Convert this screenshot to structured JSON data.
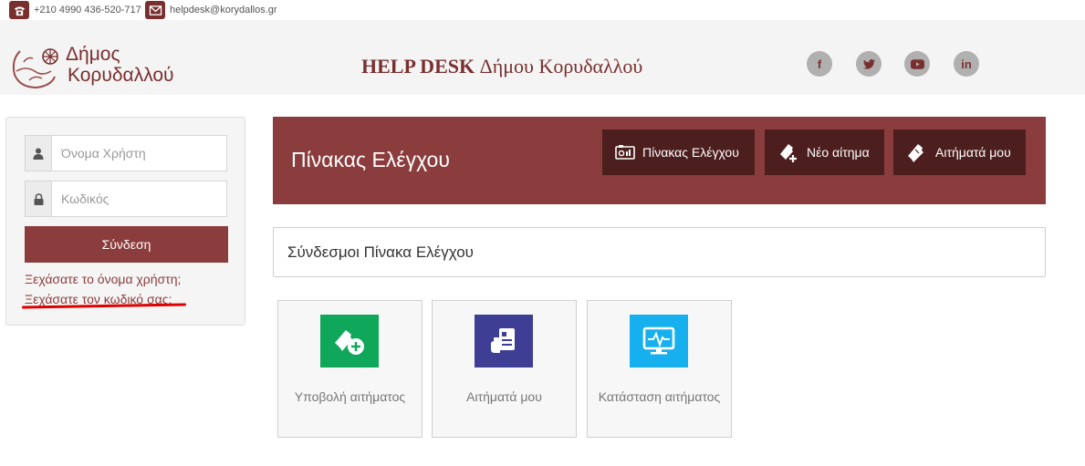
{
  "topbar": {
    "phone": "+210 4990 436-520-717",
    "email": "helpdesk@korydallos.gr"
  },
  "header": {
    "logo_line1": "Δήμος",
    "logo_line2": "Κορυδαλλού",
    "title_bold": "HELP DESK",
    "title_rest": " Δήμου Κορυδαλλού",
    "social": [
      {
        "icon": "facebook-icon",
        "glyph": "f"
      },
      {
        "icon": "twitter-icon",
        "glyph": "t"
      },
      {
        "icon": "youtube-icon",
        "glyph": "▶"
      },
      {
        "icon": "linkedin-icon",
        "glyph": "in"
      }
    ]
  },
  "login": {
    "username_placeholder": "Όνομα Χρήστη",
    "password_placeholder": "Κωδικός",
    "submit_label": "Σύνδεση",
    "forgot_username": "Ξεχάσατε το όνομα χρήστη;",
    "forgot_password": "Ξεχάσατε τον κωδικό σας;"
  },
  "banner": {
    "title": "Πίνακας Ελέγχου",
    "buttons": [
      {
        "label": "Πίνακας Ελέγχου",
        "icon": "dashboard-icon"
      },
      {
        "label": "Νέο αίτημα",
        "icon": "new-ticket-icon"
      },
      {
        "label": "Αιτήματά μου",
        "icon": "ticket-icon"
      }
    ]
  },
  "section": {
    "title": "Σύνδεσμοι Πίνακα Ελέγχου"
  },
  "tiles": [
    {
      "label": "Υποβολή αιτήματος",
      "icon": "submit-ticket-icon",
      "color": "#0fa85a"
    },
    {
      "label": "Αιτήματά μου",
      "icon": "my-tickets-icon",
      "color": "#3e3f94"
    },
    {
      "label": "Κατάσταση αιτήματος",
      "icon": "status-monitor-icon",
      "color": "#17b0ee"
    }
  ],
  "colors": {
    "brand": "#8b3c3c",
    "brand_dark": "#4c1e1e"
  }
}
